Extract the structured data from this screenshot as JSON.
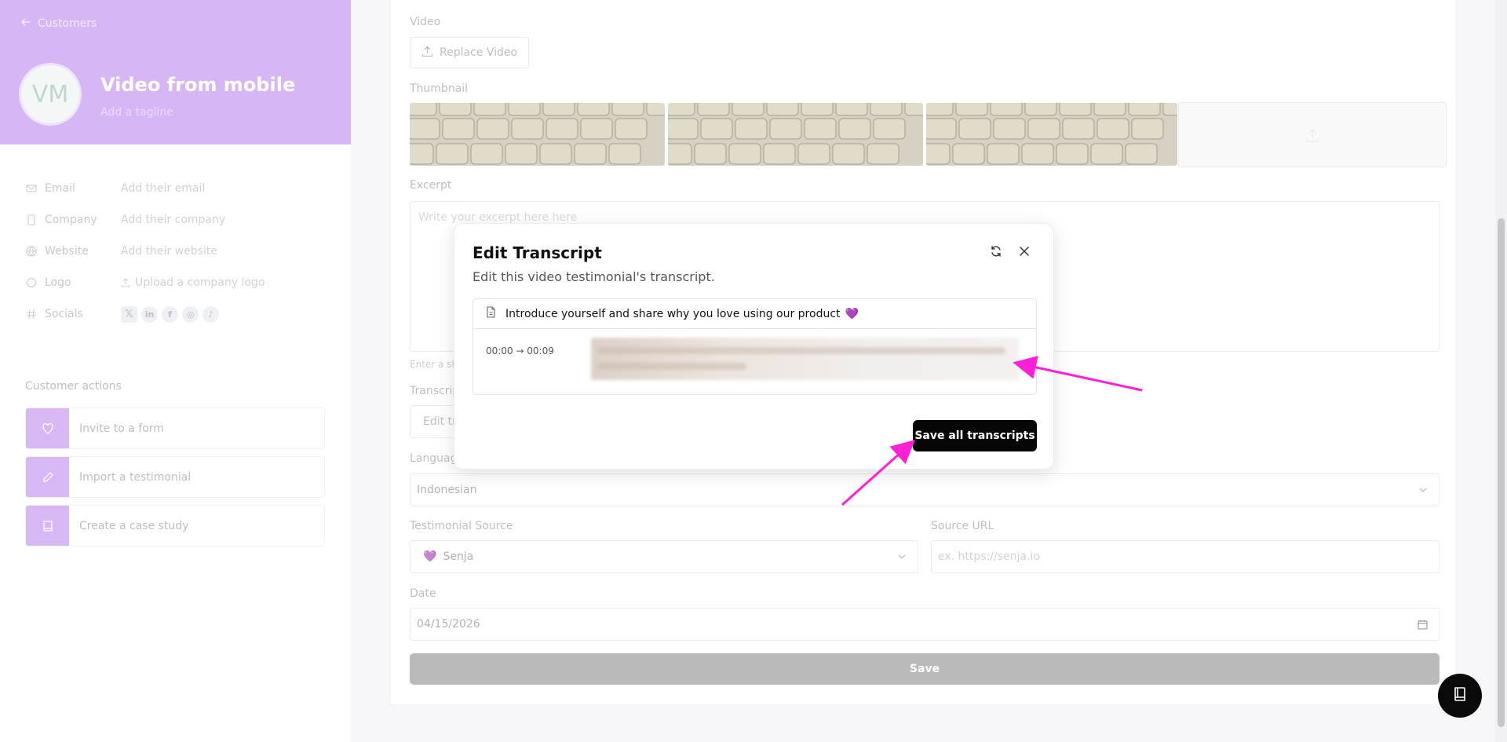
{
  "sidebar": {
    "back_label": "Customers",
    "avatar_initials": "VM",
    "name": "Video from mobile",
    "tagline_placeholder": "Add a tagline",
    "fields": [
      {
        "label": "Email",
        "value": "Add their email",
        "icon": "mail-icon"
      },
      {
        "label": "Company",
        "value": "Add their company",
        "icon": "building-icon"
      },
      {
        "label": "Website",
        "value": "Add their website",
        "icon": "globe-icon"
      },
      {
        "label": "Logo",
        "value": "Upload a company logo",
        "icon": "circle-icon"
      },
      {
        "label": "Socials",
        "value": "",
        "icon": "hash-icon"
      }
    ],
    "actions_title": "Customer actions",
    "actions": [
      {
        "label": "Invite to a form",
        "icon": "heart-icon"
      },
      {
        "label": "Import a testimonial",
        "icon": "pencil-icon"
      },
      {
        "label": "Create a case study",
        "icon": "book-icon"
      }
    ]
  },
  "main": {
    "video_label": "Video",
    "replace_video": "Replace Video",
    "thumbnail_label": "Thumbnail",
    "excerpt_label": "Excerpt",
    "excerpt_placeholder": "Write your excerpt here here",
    "excerpt_hint": "Enter a sh",
    "transcript_label": "Transcrip",
    "transcript_button": "Edit tr",
    "language_label": "Languag",
    "language_value": "Indonesian",
    "source_label": "Testimonial Source",
    "source_value": "Senja",
    "source_url_label": "Source URL",
    "source_url_placeholder": "ex. https://senja.io",
    "date_label": "Date",
    "date_value": "04/15/2026",
    "save_label": "Save"
  },
  "modal": {
    "title": "Edit Transcript",
    "subtitle": "Edit this video testimonial's transcript.",
    "question": "Introduce yourself and share why you love using our product",
    "time_range": "00:00 → 00:09",
    "save_all": "Save all transcripts"
  },
  "colors": {
    "accent": "#c394f0",
    "annotation": "#ff1fd7"
  }
}
